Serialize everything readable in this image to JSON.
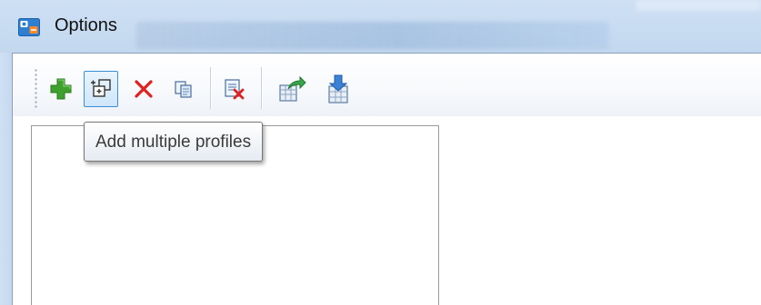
{
  "window": {
    "title": "Options",
    "icon": "app-profile-icon"
  },
  "toolbar": {
    "buttons": [
      {
        "icon": "add-plus-icon",
        "name": "add-profile-button"
      },
      {
        "icon": "add-multiple-icon",
        "name": "add-multiple-profiles-button"
      },
      {
        "icon": "delete-x-icon",
        "name": "delete-profile-button"
      },
      {
        "icon": "copy-icon",
        "name": "copy-profile-button"
      },
      {
        "icon": "delete-all-icon",
        "name": "delete-all-profiles-button"
      },
      {
        "icon": "export-icon",
        "name": "export-button"
      },
      {
        "icon": "import-icon",
        "name": "import-button"
      }
    ]
  },
  "tooltip": {
    "text": "Add multiple profiles"
  },
  "colors": {
    "titlebar": "#c7dbf1",
    "hover_border": "#3a8fd6",
    "add_green": "#3fa02e",
    "delete_red": "#e02020"
  }
}
